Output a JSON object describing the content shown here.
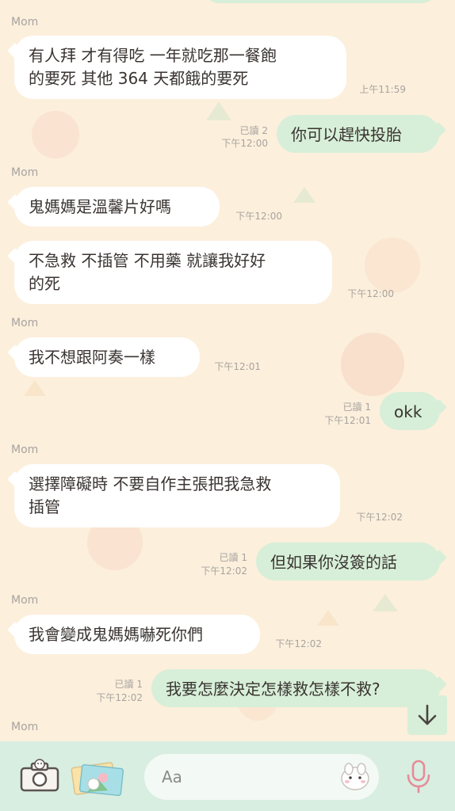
{
  "sender_name": "Mom",
  "messages": [
    {
      "side": "in",
      "lines": [
        "有人拜 才有得吃 一年就吃那一餐飽",
        "的要死 其他 364 天都餓的要死"
      ],
      "time": "上午11:59"
    },
    {
      "side": "out",
      "lines": [
        "你可以趕快投胎"
      ],
      "read": "已讀 2",
      "time": "下午12:00"
    },
    {
      "side": "in",
      "lines": [
        "鬼媽媽是溫馨片好嗎"
      ],
      "time": "下午12:00"
    },
    {
      "side": "in",
      "lines": [
        "不急救 不插管 不用藥 就讓我好好",
        "的死"
      ],
      "time": "下午12:00"
    },
    {
      "side": "in",
      "lines": [
        "我不想跟阿奏一樣"
      ],
      "time": "下午12:01"
    },
    {
      "side": "out",
      "lines": [
        "okk"
      ],
      "read": "已讀 1",
      "time": "下午12:01"
    },
    {
      "side": "in",
      "lines": [
        "選擇障礙時 不要自作主張把我急救",
        "插管"
      ],
      "time": "下午12:02"
    },
    {
      "side": "out",
      "lines": [
        "但如果你沒簽的話"
      ],
      "read": "已讀 1",
      "time": "下午12:02"
    },
    {
      "side": "in",
      "lines": [
        "我會變成鬼媽媽嚇死你們"
      ],
      "time": "下午12:02"
    },
    {
      "side": "out",
      "lines": [
        "我要怎麼決定怎樣救怎樣不救?"
      ],
      "read": "已讀 1",
      "time": "下午12:02"
    }
  ],
  "input": {
    "placeholder": "Aa"
  },
  "icons": {
    "camera": "camera-icon",
    "photos": "photo-gallery-icon",
    "sticker": "sticker-icon",
    "mic": "microphone-icon",
    "scroll_down": "arrow-down-icon"
  },
  "colors": {
    "background": "#fcefdc",
    "incoming_bubble": "#ffffff",
    "outgoing_bubble": "#d7efd8",
    "toolbar": "#d8eee0",
    "mic": "#e58c9a"
  }
}
